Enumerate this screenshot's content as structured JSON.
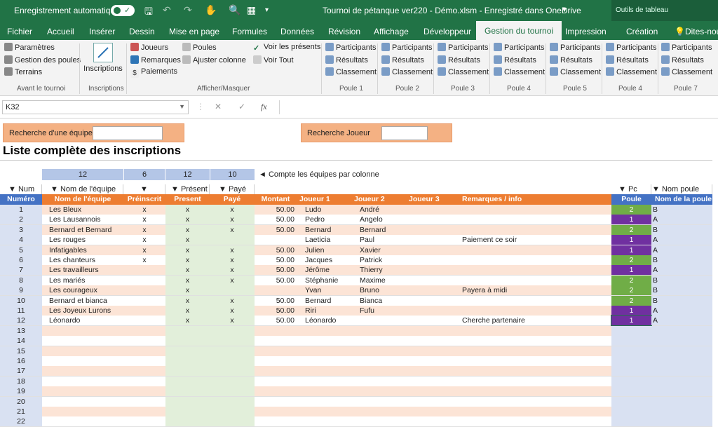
{
  "titlebar": {
    "autosave": "Enregistrement automatique",
    "title": "Tournoi de pétanque ver220 - Démo.xlsm  -  Enregistré dans OneDrive",
    "context": "Outils de tableau"
  },
  "tabs": [
    "Fichier",
    "Accueil",
    "Insérer",
    "Dessin",
    "Mise en page",
    "Formules",
    "Données",
    "Révision",
    "Affichage",
    "Développeur",
    "Gestion du tournoi",
    "Impression",
    "Création",
    "Dites-nou"
  ],
  "ribbon": {
    "avant": {
      "items": [
        "Paramètres",
        "Gestion des poules",
        "Terrains"
      ],
      "label": "Avant le tournoi"
    },
    "inscriptions": {
      "button": "Inscriptions",
      "label": "Inscriptions"
    },
    "afficher": {
      "items": [
        "Joueurs",
        "Remarques",
        "Paiements",
        "Poules",
        "Ajuster colonne",
        "Voir les présents",
        "Voir Tout"
      ],
      "label": "Afficher/Masquer"
    },
    "poule_items": [
      "Participants",
      "Résultats",
      "Classement"
    ],
    "poule_labels": [
      "Poule 1",
      "Poule 2",
      "Poule 3",
      "Poule 4",
      "Poule 5",
      "Poule 4",
      "Poule 7"
    ]
  },
  "namebox": "K32",
  "search": {
    "team_label": "Recherche d'une équipe",
    "player_label": "Recherche Joueur"
  },
  "page_title": "Liste complète des inscriptions",
  "counts": {
    "values": [
      "12",
      "6",
      "12",
      "10"
    ],
    "note": "◄ Compte les équipes par colonne"
  },
  "filters": [
    "▼ Num",
    "▼ Nom de l'équipe",
    "▼",
    "▼ Présent",
    "▼ Payé",
    "▼ Pc",
    "▼ Nom poule"
  ],
  "headers": [
    "Numéro",
    "Nom de l'équipe",
    "Préinscrit",
    "Present",
    "Payé",
    "Montant",
    "Joueur 1",
    "Joueur 2",
    "Joueur 3",
    "Remarques / info",
    "Poule",
    "Nom de la poule"
  ],
  "rows": [
    {
      "num": "1",
      "team": "Les Bleux",
      "pre": "x",
      "pres": "x",
      "paye": "x",
      "mont": "50.00",
      "j1": "Ludo",
      "j2": "André",
      "j3": "",
      "rem": "",
      "poule": "2",
      "np": "B"
    },
    {
      "num": "2",
      "team": "Les Lausannois",
      "pre": "x",
      "pres": "x",
      "paye": "x",
      "mont": "50.00",
      "j1": "Pedro",
      "j2": "Angelo",
      "j3": "",
      "rem": "",
      "poule": "1",
      "np": "A"
    },
    {
      "num": "3",
      "team": "Bernard et Bernard",
      "pre": "x",
      "pres": "x",
      "paye": "x",
      "mont": "50.00",
      "j1": "Bernard",
      "j2": "Bernard",
      "j3": "",
      "rem": "",
      "poule": "2",
      "np": "B"
    },
    {
      "num": "4",
      "team": "Les rouges",
      "pre": "x",
      "pres": "x",
      "paye": "",
      "mont": "",
      "j1": "Laeticia",
      "j2": "Paul",
      "j3": "",
      "rem": "Paiement ce soir",
      "poule": "1",
      "np": "A"
    },
    {
      "num": "5",
      "team": "Infatigables",
      "pre": "x",
      "pres": "x",
      "paye": "x",
      "mont": "50.00",
      "j1": "Julien",
      "j2": "Xavier",
      "j3": "",
      "rem": "",
      "poule": "1",
      "np": "A"
    },
    {
      "num": "6",
      "team": "Les chanteurs",
      "pre": "x",
      "pres": "x",
      "paye": "x",
      "mont": "50.00",
      "j1": "Jacques",
      "j2": "Patrick",
      "j3": "",
      "rem": "",
      "poule": "2",
      "np": "B"
    },
    {
      "num": "7",
      "team": "Les travailleurs",
      "pre": "",
      "pres": "x",
      "paye": "x",
      "mont": "50.00",
      "j1": "Jérôme",
      "j2": "Thierry",
      "j3": "",
      "rem": "",
      "poule": "1",
      "np": "A"
    },
    {
      "num": "8",
      "team": "Les mariés",
      "pre": "",
      "pres": "x",
      "paye": "x",
      "mont": "50.00",
      "j1": "Stéphanie",
      "j2": "Maxime",
      "j3": "",
      "rem": "",
      "poule": "2",
      "np": "B"
    },
    {
      "num": "9",
      "team": "Les courageux",
      "pre": "",
      "pres": "x",
      "paye": "",
      "mont": "",
      "j1": "Yvan",
      "j2": "Bruno",
      "j3": "",
      "rem": "Payera à midi",
      "poule": "2",
      "np": "B"
    },
    {
      "num": "10",
      "team": "Bernard et bianca",
      "pre": "",
      "pres": "x",
      "paye": "x",
      "mont": "50.00",
      "j1": "Bernard",
      "j2": "Bianca",
      "j3": "",
      "rem": "",
      "poule": "2",
      "np": "B"
    },
    {
      "num": "11",
      "team": "Les Joyeux Lurons",
      "pre": "",
      "pres": "x",
      "paye": "x",
      "mont": "50.00",
      "j1": "Riri",
      "j2": "Fufu",
      "j3": "",
      "rem": "",
      "poule": "1",
      "np": "A"
    },
    {
      "num": "12",
      "team": "Léonardo",
      "pre": "",
      "pres": "x",
      "paye": "x",
      "mont": "50.00",
      "j1": "Léonardo",
      "j2": "",
      "j3": "",
      "rem": "Cherche partenaire",
      "poule": "1",
      "np": "A"
    },
    {
      "num": "13"
    },
    {
      "num": "14"
    },
    {
      "num": "15"
    },
    {
      "num": "16"
    },
    {
      "num": "17"
    },
    {
      "num": "18"
    },
    {
      "num": "19"
    },
    {
      "num": "20"
    },
    {
      "num": "21"
    },
    {
      "num": "22"
    }
  ],
  "colors": {
    "excel_green": "#217346",
    "orange": "#ed7d31",
    "blue": "#4472c4",
    "pool_a": "#7030a0",
    "pool_b": "#70ad47",
    "row_odd": "#fce4d6"
  }
}
